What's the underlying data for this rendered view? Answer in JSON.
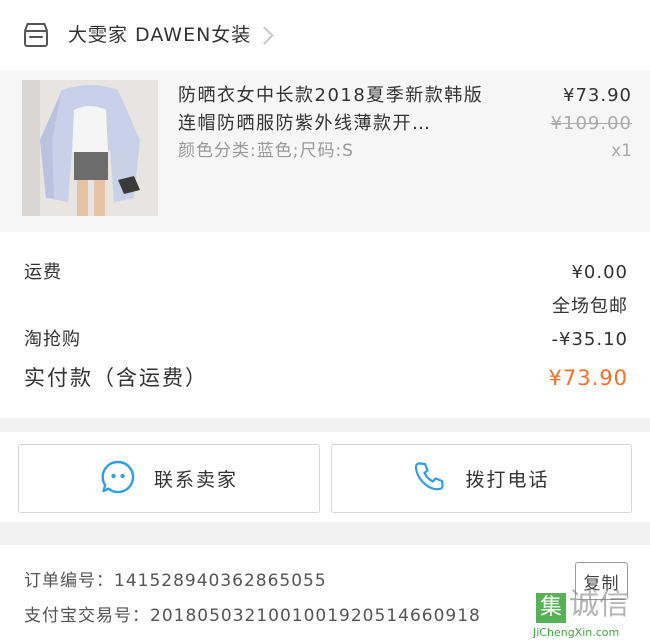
{
  "store": {
    "name": "大雯家 DAWEN女装",
    "icon": "store-icon",
    "chevron": "chevron-right-icon"
  },
  "product": {
    "title": "防晒衣女中长款2018夏季新款韩版连帽防晒服防紫外线薄款开…",
    "attributes": "颜色分类:蓝色;尺码:S",
    "price": "¥73.90",
    "original_price": "¥109.00",
    "quantity": "x1"
  },
  "fees": {
    "shipping_label": "运费",
    "shipping_value": "¥0.00",
    "shipping_note": "全场包邮",
    "discount_label": "淘抢购",
    "discount_value": "-¥35.10",
    "total_label": "实付款（含运费）",
    "total_value": "¥73.90"
  },
  "actions": {
    "contact_seller": "联系卖家",
    "contact_icon": "chat-icon",
    "call_phone": "拨打电话",
    "call_icon": "phone-icon"
  },
  "order": {
    "order_number_label": "订单编号：",
    "order_number": "141528940362865055",
    "copy_label": "复制",
    "alipay_label": "支付宝交易号：",
    "alipay_number": "2018050321001001920514660918"
  },
  "watermark": {
    "logo_char": "集",
    "name": "诚信",
    "site": "JiChengXin.com"
  },
  "colors": {
    "accent_orange": "#f36f25",
    "icon_blue": "#2e9ee6",
    "text": "#333333",
    "muted": "#999999",
    "background": "#f2f2f2"
  }
}
